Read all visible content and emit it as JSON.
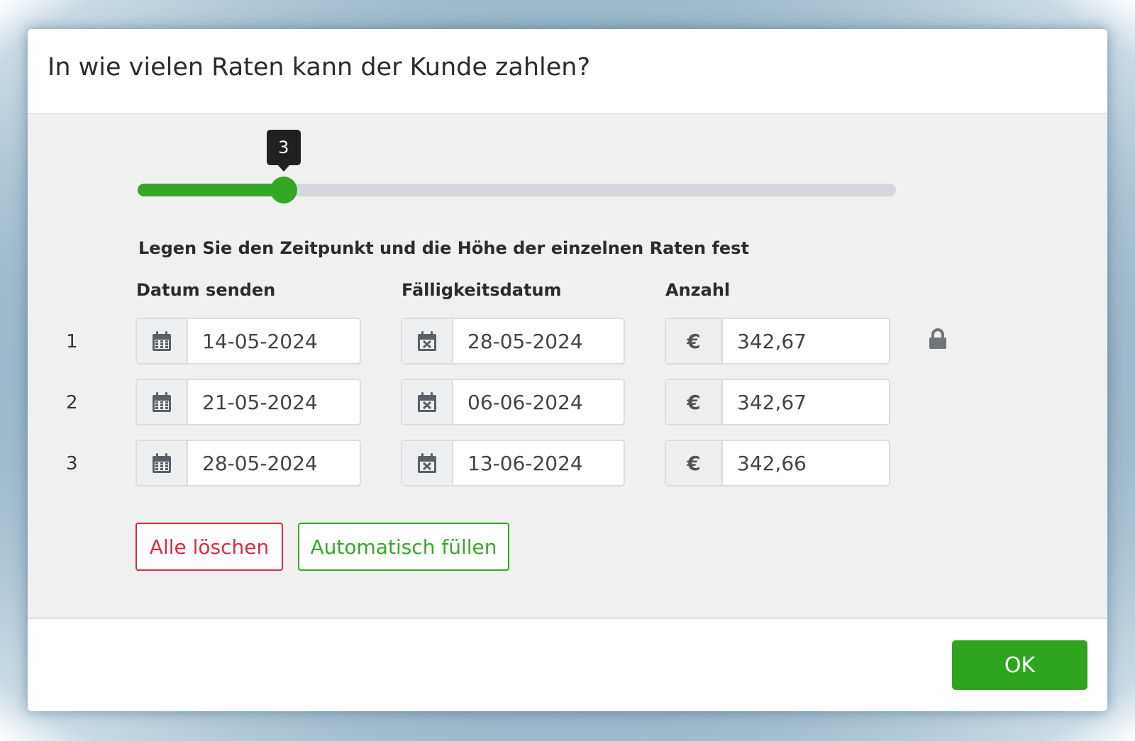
{
  "dialog": {
    "title": "In wie vielen Raten kann der Kunde zahlen?",
    "section_title": "Legen Sie den Zeitpunkt und die Höhe der einzelnen Raten fest"
  },
  "slider": {
    "value": 3,
    "value_label": "3",
    "min": 1,
    "max": 12,
    "accent_color": "#34a825"
  },
  "columns": {
    "send_date": "Datum senden",
    "due_date": "Fälligkeitsdatum",
    "amount": "Anzahl"
  },
  "rows": [
    {
      "number": "1",
      "send_date": "14-05-2024",
      "due_date": "28-05-2024",
      "amount": "342,67",
      "locked": true
    },
    {
      "number": "2",
      "send_date": "21-05-2024",
      "due_date": "06-06-2024",
      "amount": "342,67",
      "locked": false
    },
    {
      "number": "3",
      "send_date": "28-05-2024",
      "due_date": "13-06-2024",
      "amount": "342,66",
      "locked": false
    }
  ],
  "currency_symbol": "€",
  "icons": {
    "send_date": "calendar-icon",
    "due_date": "calendar-x-icon",
    "lock": "lock-icon"
  },
  "buttons": {
    "clear_all": "Alle löschen",
    "auto_fill": "Automatisch füllen",
    "ok": "OK"
  },
  "colors": {
    "primary_green": "#2fa51f",
    "danger_red": "#d42f3e"
  }
}
